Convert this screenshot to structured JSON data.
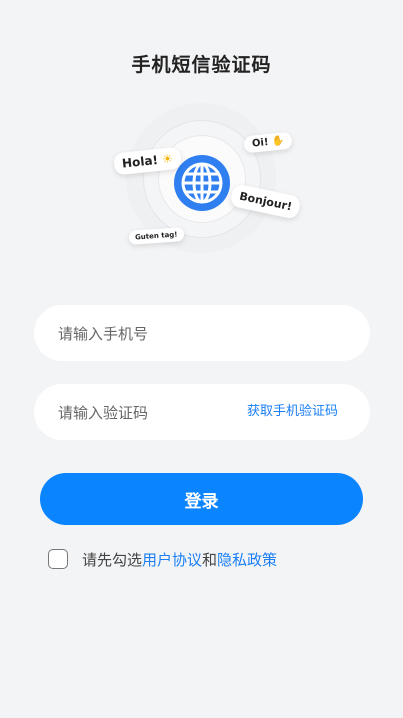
{
  "page": {
    "title": "手机短信验证码"
  },
  "hero": {
    "bubbles": {
      "hola": "Hola!",
      "oi": "Oi!",
      "bonjour": "Bonjour!",
      "guten": "Guten tag!"
    }
  },
  "form": {
    "phone_placeholder": "请输入手机号",
    "code_placeholder": "请输入验证码",
    "get_code_label": "获取手机验证码",
    "login_label": "登录"
  },
  "agreement": {
    "prefix": "请先勾选",
    "user_agreement": "用户协议",
    "and": "和",
    "privacy_policy": "隐私政策"
  },
  "colors": {
    "accent": "#0a84ff",
    "link": "#1a7ef5",
    "background": "#f3f4f6",
    "globe": "#2f7ff0"
  }
}
